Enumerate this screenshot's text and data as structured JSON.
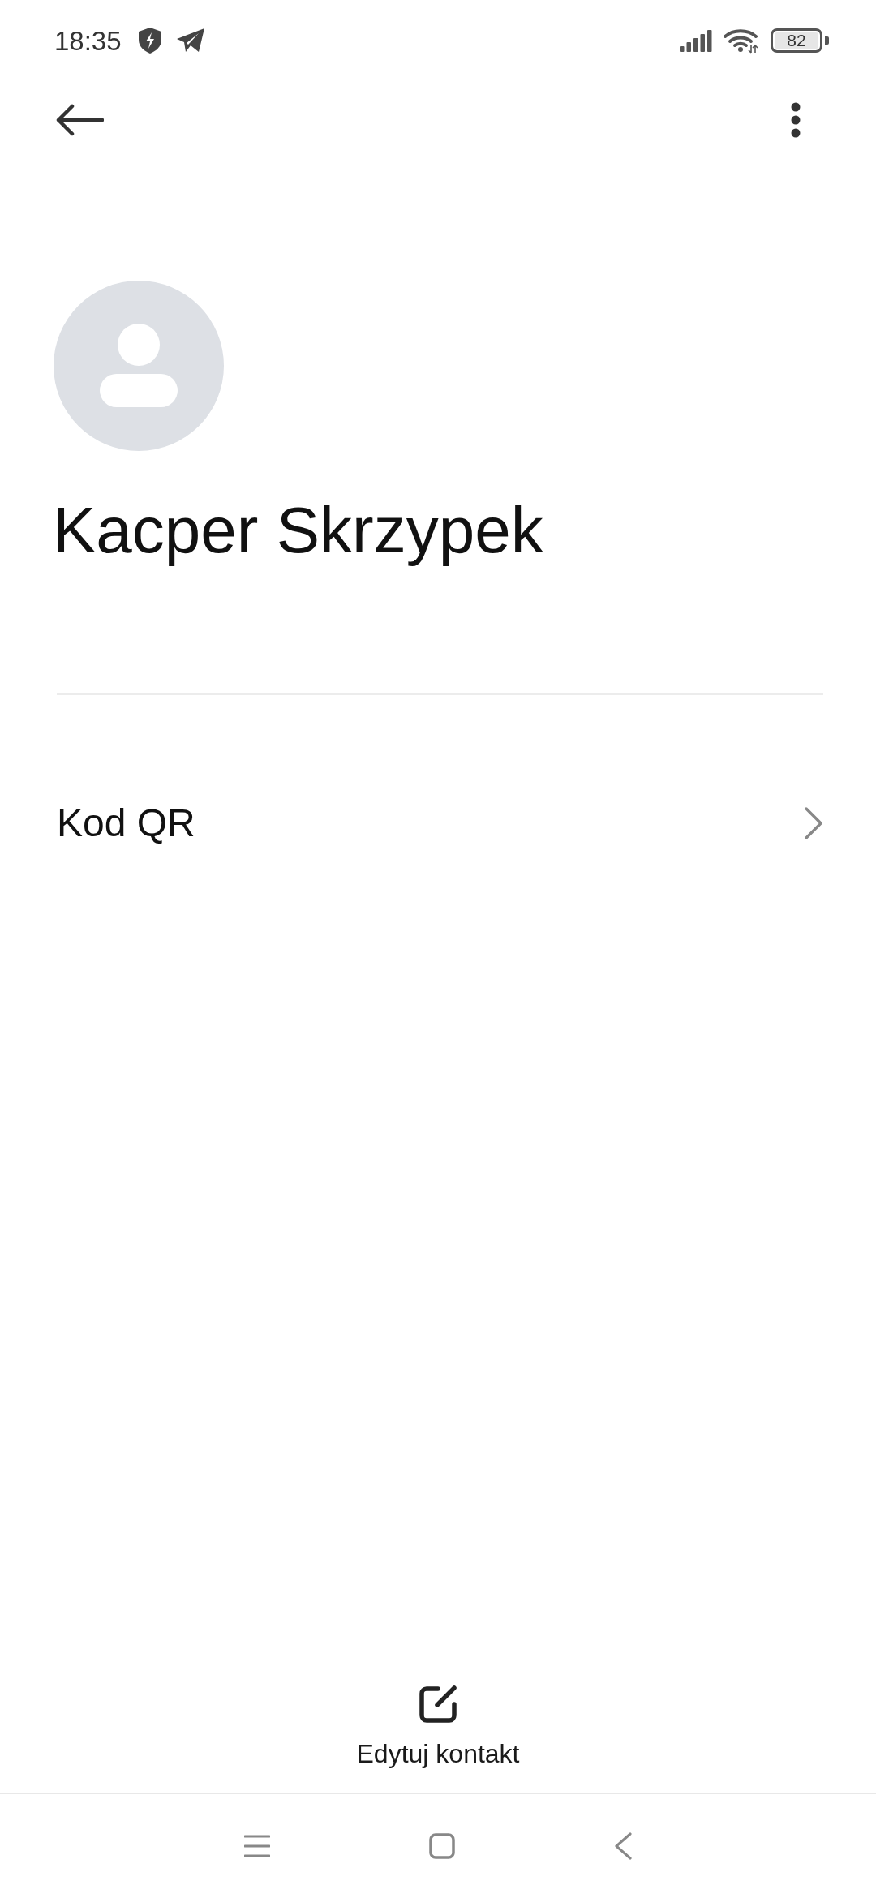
{
  "status_bar": {
    "time": "18:35",
    "battery": "82"
  },
  "contact": {
    "name": "Kacper Skrzypek"
  },
  "items": [
    {
      "label": "Kod QR"
    }
  ],
  "actions": [
    {
      "label": "Edytuj kontakt"
    }
  ]
}
